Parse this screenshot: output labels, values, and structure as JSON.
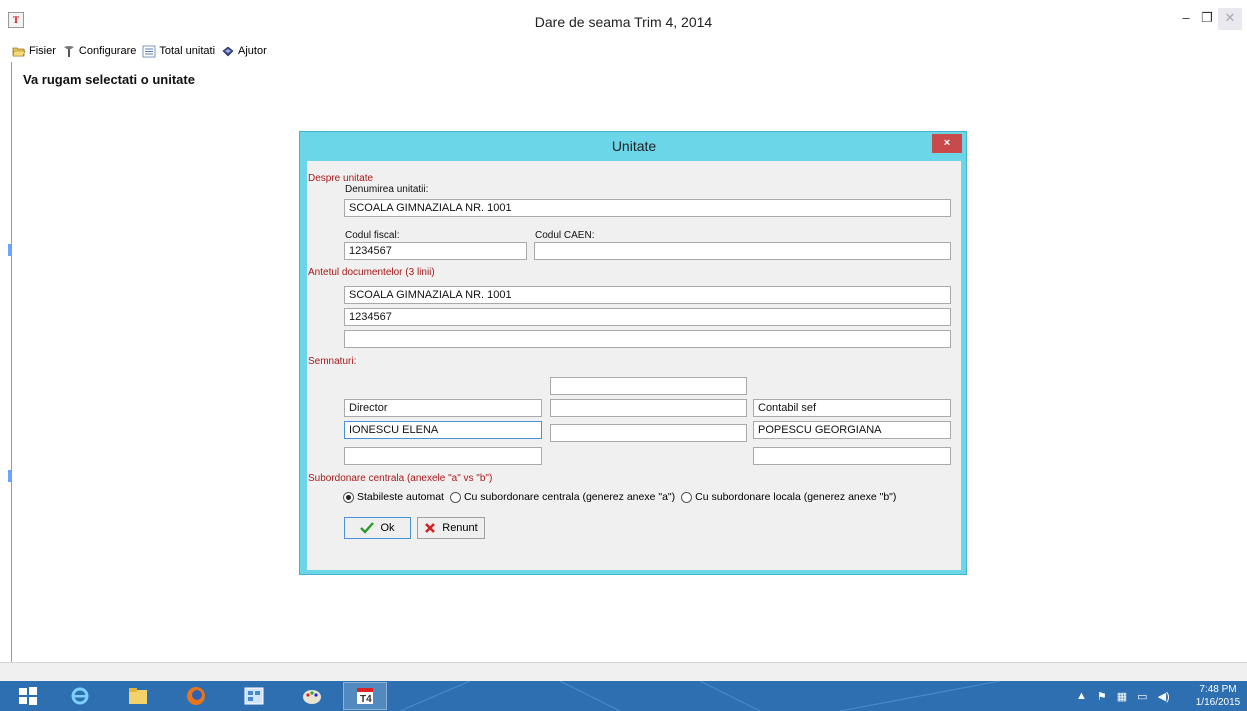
{
  "window": {
    "title": "Dare de seama Trim 4, 2014",
    "icon_label": "T",
    "minimize": "–",
    "maximize": "❐",
    "close": "✕"
  },
  "menu": {
    "items": [
      {
        "label": "Fisier",
        "icon": "folder-open-icon"
      },
      {
        "label": "Configurare",
        "icon": "tools-icon"
      },
      {
        "label": "Total unitati",
        "icon": "list-icon"
      },
      {
        "label": "Ajutor",
        "icon": "help-book-icon"
      }
    ]
  },
  "main": {
    "prompt": "Va rugam selectati o unitate"
  },
  "dialog": {
    "title": "Unitate",
    "close": "×",
    "despre_section": "Despre unitate",
    "denumire_label": "Denumirea unitatii:",
    "denumire_value": "SCOALA GIMNAZIALA NR. 1001",
    "cod_fiscal_label": "Codul fiscal:",
    "cod_fiscal_value": "1234567",
    "cod_caen_label": "Codul CAEN:",
    "cod_caen_value": "",
    "antet_section": "Antetul documentelor (3 linii)",
    "antet_lines": [
      "SCOALA GIMNAZIALA NR. 1001",
      "1234567",
      ""
    ],
    "semnaturi_section": "Semnaturi:",
    "sig_left": [
      "Director",
      "IONESCU ELENA",
      ""
    ],
    "sig_middle": [
      "",
      "",
      ""
    ],
    "sig_right": [
      "Contabil sef",
      "POPESCU GEORGIANA",
      ""
    ],
    "subordonare_section": "Subordonare centrala (anexele \"a\" vs \"b\")",
    "radio_options": [
      {
        "label": "Stabileste automat",
        "selected": true
      },
      {
        "label": "Cu subordonare centrala (generez anexe \"a\")",
        "selected": false
      },
      {
        "label": "Cu subordonare locala (generez anexe \"b\")",
        "selected": false
      }
    ],
    "ok_label": "Ok",
    "cancel_label": "Renunt"
  },
  "tray": {
    "time": "7:48 PM",
    "date": "1/16/2015"
  },
  "colors": {
    "dialog_frame": "#6ad6e8",
    "section_label": "#a81a1a",
    "taskbar": "#2d6fb0"
  }
}
